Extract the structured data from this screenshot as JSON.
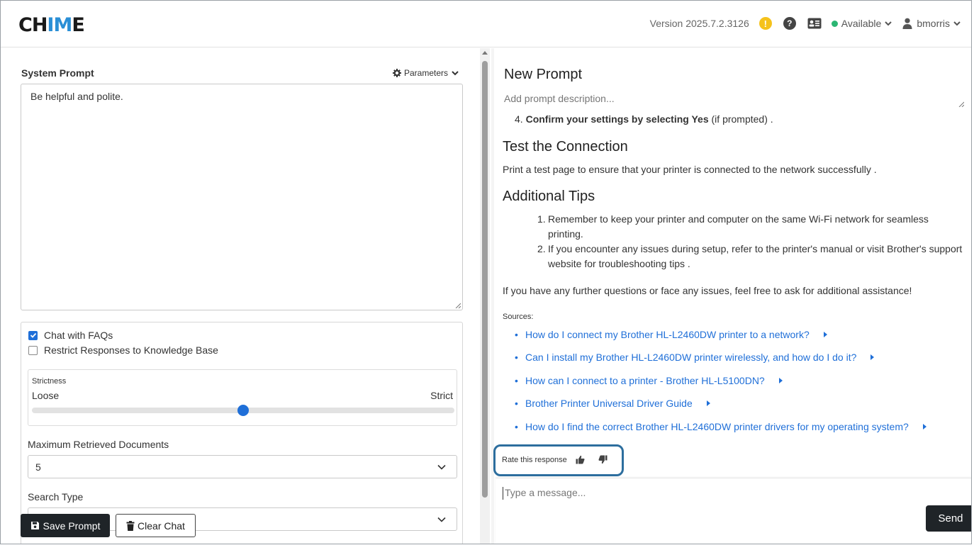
{
  "app": {
    "logo_prefix": "CH",
    "logo_highlight": "IM",
    "logo_suffix": "E"
  },
  "header": {
    "version": "Version 2025.7.2.3126",
    "warning_glyph": "!",
    "help_glyph": "?",
    "status": "Available",
    "status_color": "#2bb673",
    "username": "bmorris"
  },
  "left": {
    "system_prompt_label": "System Prompt",
    "parameters_label": "Parameters",
    "system_prompt_value": "Be helpful and polite.",
    "chat_with_faqs": {
      "label": "Chat with FAQs",
      "checked": true
    },
    "restrict_kb": {
      "label": "Restrict Responses to Knowledge Base",
      "checked": false
    },
    "strictness": {
      "title": "Strictness",
      "min_label": "Loose",
      "max_label": "Strict",
      "value_fraction": 0.5
    },
    "max_docs_label": "Maximum Retrieved Documents",
    "max_docs_value": "5",
    "search_type_label": "Search Type",
    "search_type_value": "",
    "save_button": "Save Prompt",
    "clear_button": "Clear Chat"
  },
  "right": {
    "prompt_title": "New Prompt",
    "prompt_description_placeholder": "Add prompt description...",
    "step4_num": "4.",
    "step4_bold": "Confirm your settings by selecting Yes",
    "step4_rest": " (if prompted) .",
    "test_heading": "Test the Connection",
    "test_text": "Print a test page to ensure that your printer is connected to the network successfully .",
    "tips_heading": "Additional Tips",
    "tips": [
      {
        "num": "1.",
        "text": "Remember to keep your printer and computer on the same Wi-Fi network for seamless printing."
      },
      {
        "num": "2.",
        "text": "If you encounter any issues during setup, refer to the printer's manual or visit Brother's support website for troubleshooting tips ."
      }
    ],
    "closing": "If you have any further questions or face any issues, feel free to ask for additional assistance!",
    "sources_label": "Sources:",
    "sources": [
      "How do I connect my Brother HL-L2460DW printer to a network?",
      "Can I install my Brother HL-L2460DW printer wirelessly, and how do I do it?",
      "How can I connect to a printer - Brother HL-L5100DN?",
      "Brother Printer Universal Driver Guide",
      "How do I find the correct Brother HL-L2460DW printer drivers for my operating system?"
    ],
    "rate_label": "Rate this response",
    "message_placeholder": "Type a message...",
    "send_button": "Send"
  },
  "colors": {
    "accent": "#1f6fd8",
    "dark_button": "#1f2428",
    "highlight_border": "#2d6e9e"
  }
}
